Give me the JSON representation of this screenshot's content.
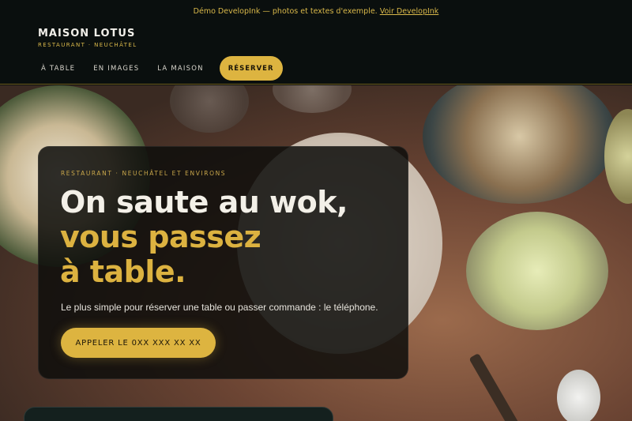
{
  "banner": {
    "text": "Démo DevelopInk — photos et textes d'exemple.",
    "link": "Voir DevelopInk"
  },
  "brand": {
    "name": "MAISON LOTUS",
    "tagline": "RESTAURANT · NEUCHÂTEL"
  },
  "nav": {
    "items": [
      "À TABLE",
      "EN IMAGES",
      "LA MAISON"
    ],
    "cta": "RÉSERVER"
  },
  "hero": {
    "eyebrow": "RESTAURANT · NEUCHÂTEL ET ENVIRONS",
    "headline_line1": "On saute au wok,",
    "headline_line2": "vous passez",
    "headline_line3": "à table.",
    "lead": "Le plus simple pour réserver une table ou passer commande : le téléphone.",
    "call_button": "APPELER LE 0XX XXX XX XX"
  },
  "colors": {
    "accent": "#ddb440",
    "background": "#0a0f0e"
  }
}
